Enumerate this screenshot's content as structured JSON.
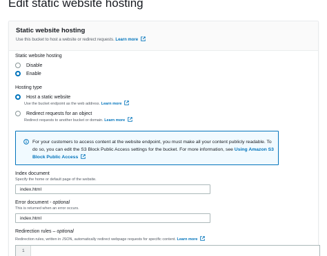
{
  "page": {
    "title": "Edit static website hosting"
  },
  "panel": {
    "title": "Static website hosting",
    "description": "Use this bucket to host a website or redirect requests.",
    "learn_more": "Learn more"
  },
  "hosting_toggle": {
    "label": "Static website hosting",
    "options": [
      {
        "label": "Disable",
        "selected": false
      },
      {
        "label": "Enable",
        "selected": true
      }
    ]
  },
  "hosting_type": {
    "label": "Hosting type",
    "options": [
      {
        "label": "Host a static website",
        "description": "Use the bucket endpoint as the web address.",
        "learn_more": "Learn more",
        "selected": true
      },
      {
        "label": "Redirect requests for an object",
        "description": "Redirect requests to another bucket or domain.",
        "learn_more": "Learn more",
        "selected": false
      }
    ]
  },
  "info": {
    "text": "For your customers to access content at the website endpoint, you must make all your content publicly readable. To do so, you can edit the S3 Block Public Access settings for the bucket. For more information, see",
    "link": "Using Amazon S3 Block Public Access"
  },
  "index_document": {
    "label": "Index document",
    "description": "Specify the home or default page of the website.",
    "value": "index.html"
  },
  "error_document": {
    "label": "Error document -",
    "optional": "optional",
    "description": "This is returned when an error occurs.",
    "value": "index.html"
  },
  "redirection_rules": {
    "label": "Redirection rules –",
    "optional": "optional",
    "description": "Redirection rules, written in JSON, automatically redirect webpage requests for specific content.",
    "learn_more": "Learn more",
    "line_number": "1"
  },
  "colors": {
    "link": "#0073bb",
    "info_bg": "#f1faff",
    "text": "#16191f",
    "muted": "#545b64"
  },
  "icons": {
    "external": "external-link-icon",
    "info": "info-circle-icon"
  }
}
